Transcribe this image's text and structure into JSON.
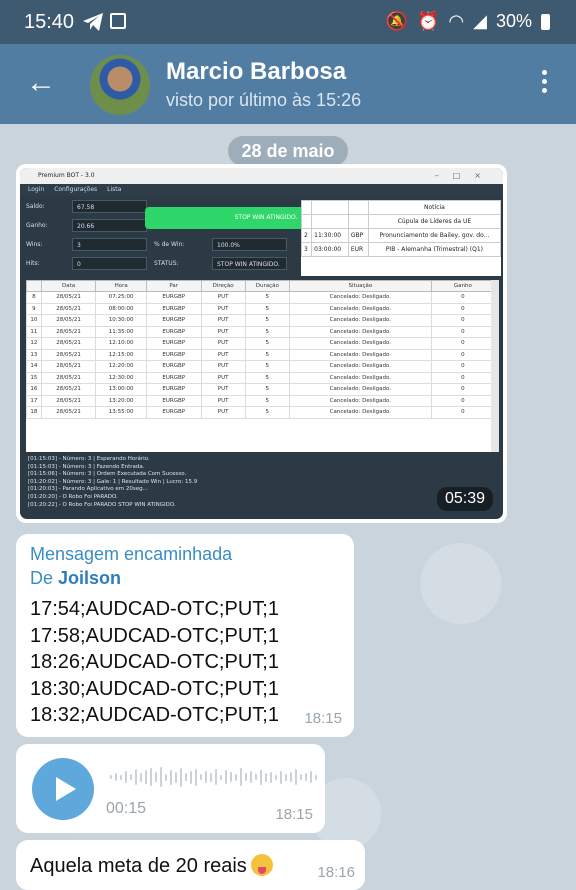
{
  "status_bar": {
    "time": "15:40",
    "battery": "30%"
  },
  "header": {
    "name": "Marcio Barbosa",
    "last_seen": "visto por último às 15:26"
  },
  "date_pill": "28 de maio",
  "screenshot": {
    "title": "Premium BOT - 3.0",
    "menu": [
      "Login",
      "Configurações",
      "Lista"
    ],
    "stats": [
      {
        "label": "Saldo:",
        "value": "67.58",
        "label2": "",
        "value2": ""
      },
      {
        "label": "Ganho:",
        "value": "20.66",
        "label2": "",
        "value2": ""
      },
      {
        "label": "Wins:",
        "value": "3",
        "label2": "% de Win:",
        "value2": "100.0%"
      },
      {
        "label": "Hits:",
        "value": "0",
        "label2": "STATUS:",
        "value2": "STOP WIN ATINGIDO."
      }
    ],
    "stop_banner": "STOP WIN ATINGIDO.",
    "news_header": "Notícia",
    "news": [
      {
        "n": "",
        "time": "",
        "cur": "",
        "text": "Cúpula de Líderes da UE"
      },
      {
        "n": "2",
        "time": "11:30:00",
        "cur": "GBP",
        "text": "Pronunciamento de Bailey, gov. do..."
      },
      {
        "n": "3",
        "time": "03:00:00",
        "cur": "EUR",
        "text": "PIB - Alemanha (Trimestral) (Q1)"
      }
    ],
    "grid_headers": [
      "",
      "Data",
      "Hora",
      "Par",
      "Direção",
      "Duração",
      "Situação",
      "Ganho"
    ],
    "grid_rows": [
      [
        "8",
        "28/05/21",
        "07:25:00",
        "EURGBP",
        "PUT",
        "5",
        "Cancelado: Desligado.",
        "0"
      ],
      [
        "9",
        "28/05/21",
        "08:00:00",
        "EURGBP",
        "PUT",
        "5",
        "Cancelado: Desligado.",
        "0"
      ],
      [
        "10",
        "28/05/21",
        "10:30:00",
        "EURGBP",
        "PUT",
        "5",
        "Cancelado: Desligado.",
        "0"
      ],
      [
        "11",
        "28/05/21",
        "11:35:00",
        "EURGBP",
        "PUT",
        "5",
        "Cancelado: Desligado.",
        "0"
      ],
      [
        "12",
        "28/05/21",
        "12:10:00",
        "EURGBP",
        "PUT",
        "5",
        "Cancelado: Desligado.",
        "0"
      ],
      [
        "13",
        "28/05/21",
        "12:15:00",
        "EURGBP",
        "PUT",
        "5",
        "Cancelado: Desligado.",
        "0"
      ],
      [
        "14",
        "28/05/21",
        "12:20:00",
        "EURGBP",
        "PUT",
        "5",
        "Cancelado: Desligado.",
        "0"
      ],
      [
        "15",
        "28/05/21",
        "12:30:00",
        "EURGBP",
        "PUT",
        "5",
        "Cancelado: Desligado.",
        "0"
      ],
      [
        "16",
        "28/05/21",
        "13:00:00",
        "EURGBP",
        "PUT",
        "5",
        "Cancelado: Desligado.",
        "0"
      ],
      [
        "17",
        "28/05/21",
        "13:20:00",
        "EURGBP",
        "PUT",
        "5",
        "Cancelado: Desligado.",
        "0"
      ],
      [
        "18",
        "28/05/21",
        "13:55:00",
        "EURGBP",
        "PUT",
        "5",
        "Cancelado: Desligado.",
        "0"
      ]
    ],
    "log": [
      "[01:15:03] - Número: 3 | Esperando Horário.",
      "[01:15:03] - Número: 3 | Fazendo Entrada.",
      "[01:15:06] - Número: 3 | Ordem Executada Com Sucesso.",
      "[01:20:02] - Número: 3 | Gale: 1 | Resultado Win | Lucro: 15.9",
      "[01:20:03] - Parando Aplicativo em 20seg...",
      "[01:20:20] - O Robo Foi PARADO.",
      "[01:20:22] - O Robo Foi PARADO STOP WIN ATINGIDO."
    ],
    "duration": "05:39"
  },
  "forwarded": {
    "label": "Mensagem encaminhada",
    "from_prefix": "De",
    "from_name": "Joilson",
    "lines": [
      "17:54;AUDCAD-OTC;PUT;1",
      "17:58;AUDCAD-OTC;PUT;1",
      "18:26;AUDCAD-OTC;PUT;1",
      "18:30;AUDCAD-OTC;PUT;1",
      "18:32;AUDCAD-OTC;PUT;1"
    ],
    "time": "18:15"
  },
  "voice": {
    "duration": "00:15",
    "time": "18:15"
  },
  "last_message": {
    "text": "Aquela meta de 20 reais",
    "time": "18:16"
  }
}
